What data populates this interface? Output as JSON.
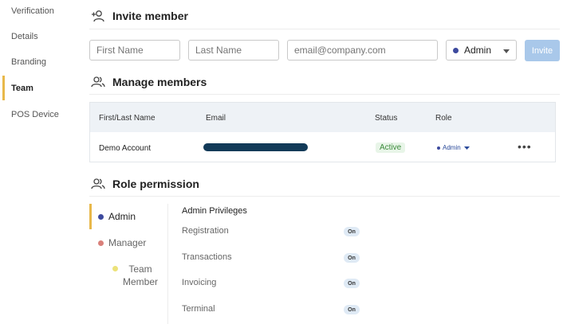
{
  "sidebar": {
    "items": [
      {
        "label": "Verification"
      },
      {
        "label": "Details"
      },
      {
        "label": "Branding"
      },
      {
        "label": "Team"
      },
      {
        "label": "POS Device"
      }
    ]
  },
  "invite": {
    "title": "Invite member",
    "first_name_placeholder": "First Name",
    "last_name_placeholder": "Last Name",
    "email_placeholder": "email@company.com",
    "role_value": "Admin",
    "invite_label": "Invite"
  },
  "manage": {
    "title": "Manage members",
    "columns": [
      "First/Last Name",
      "Email",
      "Status",
      "Role"
    ],
    "rows": [
      {
        "name": "Demo Account",
        "status": "Active",
        "role": "Admin"
      }
    ]
  },
  "roles": {
    "title": "Role permission",
    "items": [
      {
        "label": "Admin",
        "color": "#3d4a9e"
      },
      {
        "label": "Manager",
        "color": "#d9807a"
      },
      {
        "label": "Team Member",
        "color": "#ece27a"
      }
    ],
    "privileges_title": "Admin Privileges",
    "privileges": [
      {
        "label": "Registration",
        "state": "On"
      },
      {
        "label": "Transactions",
        "state": "On"
      },
      {
        "label": "Invoicing",
        "state": "On"
      },
      {
        "label": "Terminal",
        "state": "On"
      }
    ]
  },
  "colors": {
    "accent": "#e8b84a",
    "invite_button": "#a9c8ea",
    "admin": "#3d4a9e",
    "manager": "#d9807a",
    "team_member": "#ece27a"
  }
}
